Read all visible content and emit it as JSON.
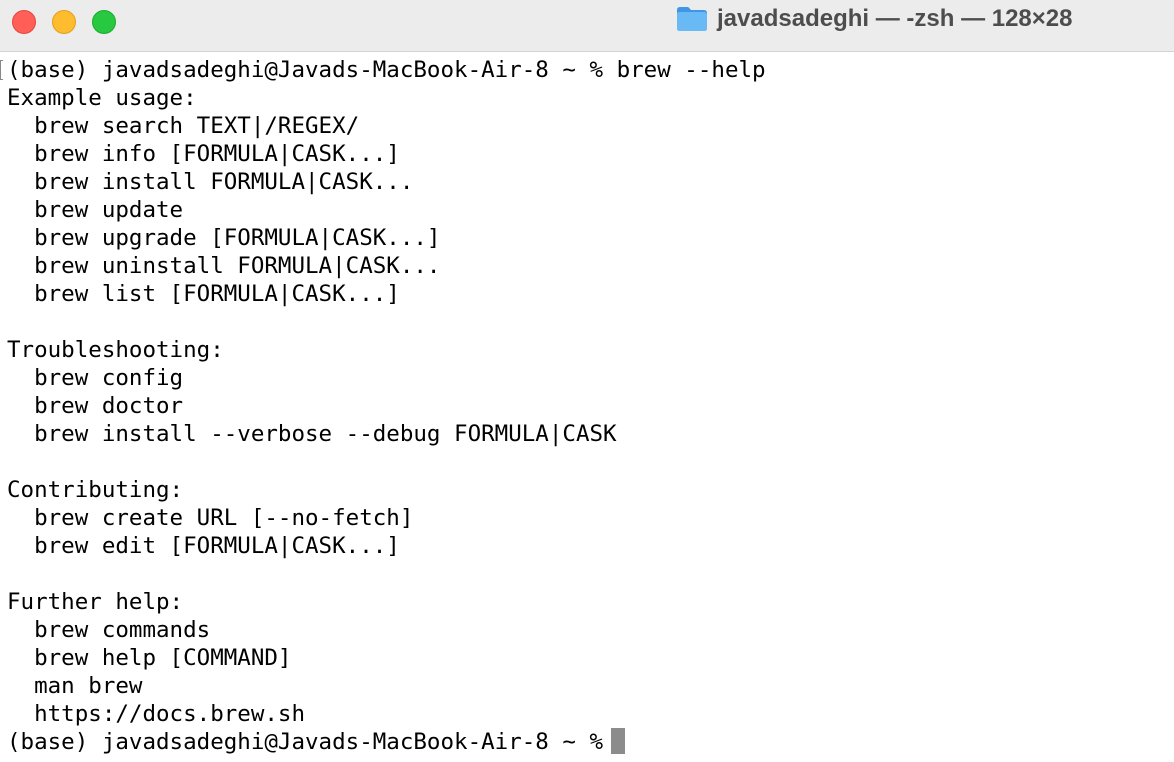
{
  "window": {
    "title": "javadsadeghi — -zsh — 128×28",
    "folder_icon": "folder-icon",
    "colors": {
      "close": "#ff5f57",
      "minimize": "#febc2e",
      "zoom": "#28c840",
      "folder": "#5aaef2"
    }
  },
  "terminal": {
    "lines": [
      "(base) javadsadeghi@Javads-MacBook-Air-8 ~ % brew --help",
      "Example usage:",
      "  brew search TEXT|/REGEX/",
      "  brew info [FORMULA|CASK...]",
      "  brew install FORMULA|CASK...",
      "  brew update",
      "  brew upgrade [FORMULA|CASK...]",
      "  brew uninstall FORMULA|CASK...",
      "  brew list [FORMULA|CASK...]",
      "",
      "Troubleshooting:",
      "  brew config",
      "  brew doctor",
      "  brew install --verbose --debug FORMULA|CASK",
      "",
      "Contributing:",
      "  brew create URL [--no-fetch]",
      "  brew edit [FORMULA|CASK...]",
      "",
      "Further help:",
      "  brew commands",
      "  brew help [COMMAND]",
      "  man brew",
      "  https://docs.brew.sh"
    ],
    "prompt": "(base) javadsadeghi@Javads-MacBook-Air-8 ~ %"
  }
}
